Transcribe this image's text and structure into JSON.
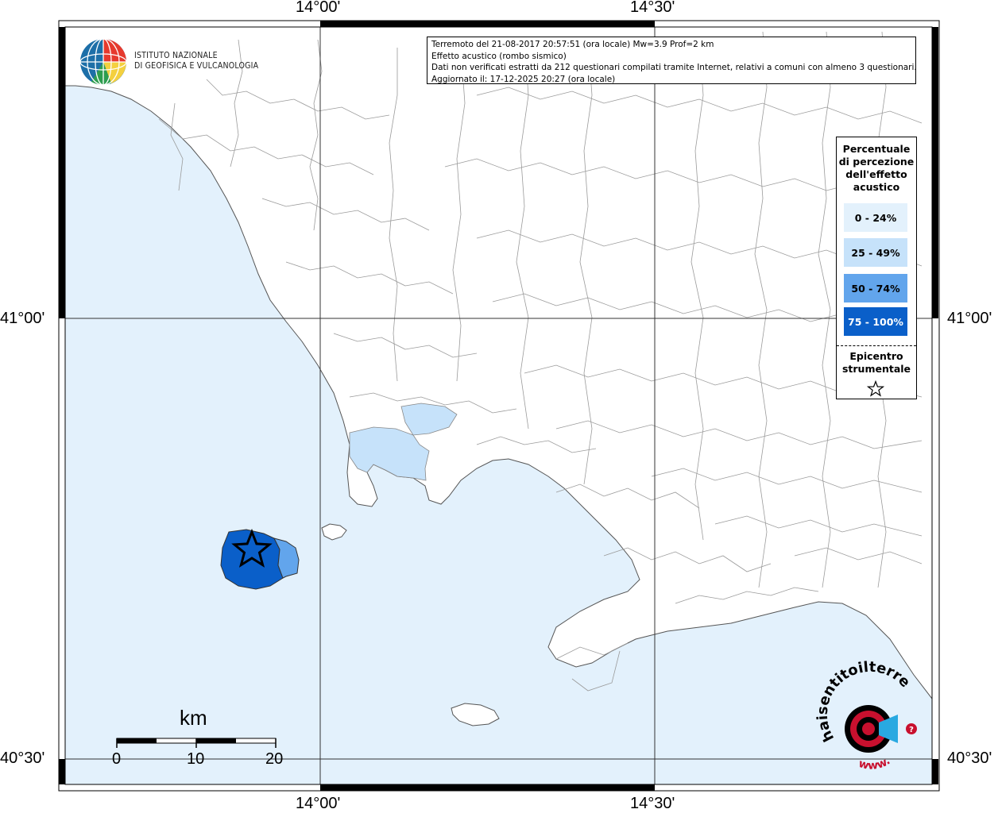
{
  "map": {
    "axis_labels": {
      "top": [
        "14°00'",
        "14°30'"
      ],
      "bottom": [
        "14°00'",
        "14°30'"
      ],
      "left": [
        "41°00'",
        "40°30'"
      ],
      "right": [
        "41°00'",
        "40°30'"
      ]
    },
    "sea_color": "#e3f1fc",
    "land_color": "#ffffff",
    "border_color": "#9a9a9a"
  },
  "info": {
    "line1": "Terremoto del 21-08-2017 20:57:51 (ora locale) Mw=3.9 Prof=2 km",
    "line2": "Effetto acustico (rombo sismico)",
    "line3": "Dati non verificati estratti da 212 questionari compilati tramite Internet, relativi a comuni con almeno 3 questionari.",
    "line4": "Aggiornato il: 17-12-2025 20:27 (ora locale)"
  },
  "logo_ingv": {
    "line1": "ISTITUTO NAZIONALE",
    "line2": "DI GEOFISICA E VULCANOLOGIA"
  },
  "logo_hsit": {
    "text_main": "haisentitoilterremoto.it",
    "text_www": "www."
  },
  "legend": {
    "title_lines": [
      "Percentuale",
      "di percezione",
      "dell'effetto",
      "acustico"
    ],
    "classes": [
      {
        "label": "0 - 24%",
        "color": "#e3f1fc"
      },
      {
        "label": "25 - 49%",
        "color": "#c6e2fa"
      },
      {
        "label": "50 - 74%",
        "color": "#62a5ec"
      },
      {
        "label": "75 - 100%",
        "color": "#0a5fc9"
      }
    ],
    "epicenter_lines": [
      "Epicentro",
      "strumentale"
    ],
    "epicenter_icon": "star-icon"
  },
  "scale_bar": {
    "unit": "km",
    "ticks": [
      "0",
      "10",
      "20"
    ]
  }
}
